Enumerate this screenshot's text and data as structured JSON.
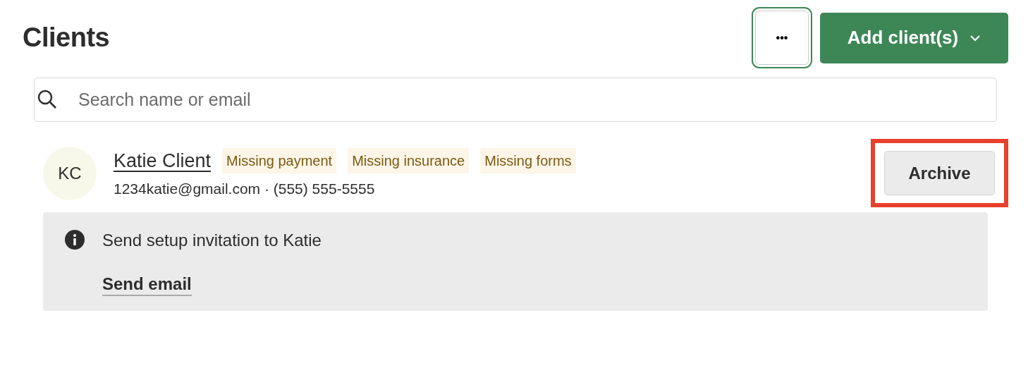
{
  "title": "Clients",
  "more_button": {
    "label": "•••",
    "focused": true
  },
  "add_button": {
    "label": "Add client(s)"
  },
  "search": {
    "placeholder": "Search name or email"
  },
  "clients": [
    {
      "initials": "KC",
      "name": "Katie Client",
      "tags": [
        "Missing payment",
        "Missing insurance",
        "Missing forms"
      ],
      "contact": "1234katie@gmail.com · (555) 555-5555",
      "archive_label": "Archive",
      "highlighted": true,
      "notice": {
        "text": "Send setup invitation to Katie",
        "link": "Send email"
      }
    }
  ]
}
